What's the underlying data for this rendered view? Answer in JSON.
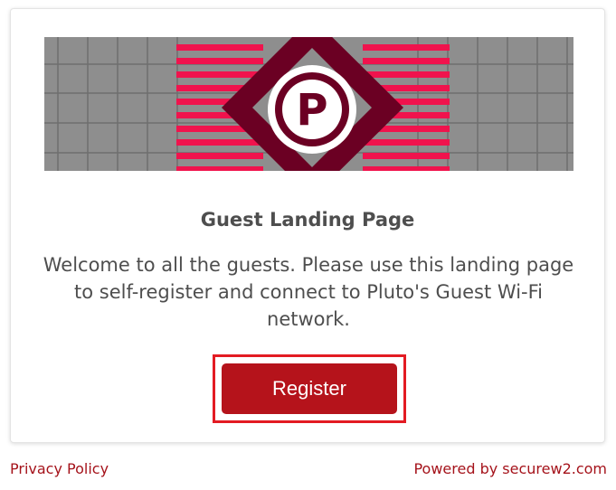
{
  "card": {
    "title": "Guest Landing Page",
    "message": "Welcome to all the guests. Please use this landing page to self-register and connect to Pluto's Guest Wi-Fi network.",
    "register_label": "Register"
  },
  "banner": {
    "logo_letter": "P",
    "colors": {
      "grid_bg": "#8e8e8e",
      "stripe": "#f0134d",
      "diamond": "#6b0023",
      "circle": "#ffffff"
    }
  },
  "footer": {
    "privacy_label": "Privacy Policy",
    "powered_label": "Powered by securew2.com"
  },
  "colors": {
    "button": "#b5131b",
    "focus_outline": "#e31b23",
    "link": "#a5131b",
    "text": "#4e4e4e"
  }
}
